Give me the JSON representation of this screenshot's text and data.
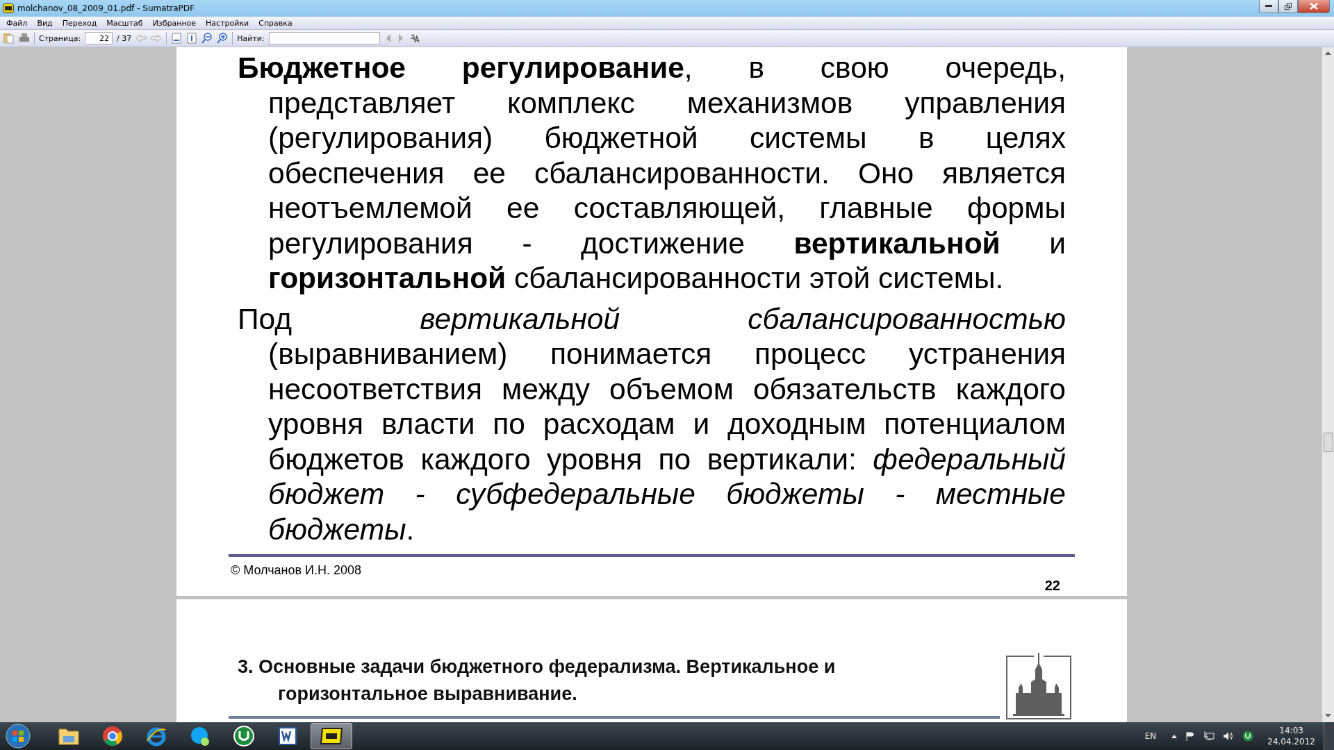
{
  "window": {
    "title": "molchanov_08_2009_01.pdf - SumatraPDF"
  },
  "menu": [
    "Файл",
    "Вид",
    "Переход",
    "Масштаб",
    "Избранное",
    "Настройки",
    "Справка"
  ],
  "toolbar": {
    "page_label": "Страница:",
    "page_value": "22",
    "page_total": "/ 37",
    "find_label": "Найти:"
  },
  "pages": [
    {
      "paragraphs": [
        "**Бюджетное регулирование**, в свою очередь, представляет комплекс механизмов управления (регулирования) бюджетной системы в целях обеспечения ее сбалансированности. Оно является неотъемлемой ее составляющей, главные формы регулирования - достижение **вертикальной** и **горизонтальной** сбалансированности этой системы.",
        "Под *вертикальной сбалансированностью* (выравниванием) понимается процесс устранения несоответствия между объемом обязательств каждого уровня власти по расходам и доходным потенциалом бюджетов каждого уровня по вертикали: *федеральный бюджет - субфедеральные бюджеты - местные бюджеты*."
      ],
      "copyright": "© Молчанов И.Н. 2008",
      "page_number": "22"
    },
    {
      "heading": "3. Основные задачи бюджетного федерализма. Вертикальное и горизонтальное выравнивание."
    }
  ],
  "taskbar": {
    "apps": [
      {
        "kind": "explorer",
        "active": false
      },
      {
        "kind": "chrome",
        "active": false
      },
      {
        "kind": "ie",
        "active": false
      },
      {
        "kind": "skype",
        "active": false
      },
      {
        "kind": "torrent",
        "active": false
      },
      {
        "kind": "word",
        "active": false
      },
      {
        "kind": "pdf",
        "active": true
      }
    ],
    "language": "EN",
    "time": "14:03",
    "date": "24.04.2012"
  }
}
